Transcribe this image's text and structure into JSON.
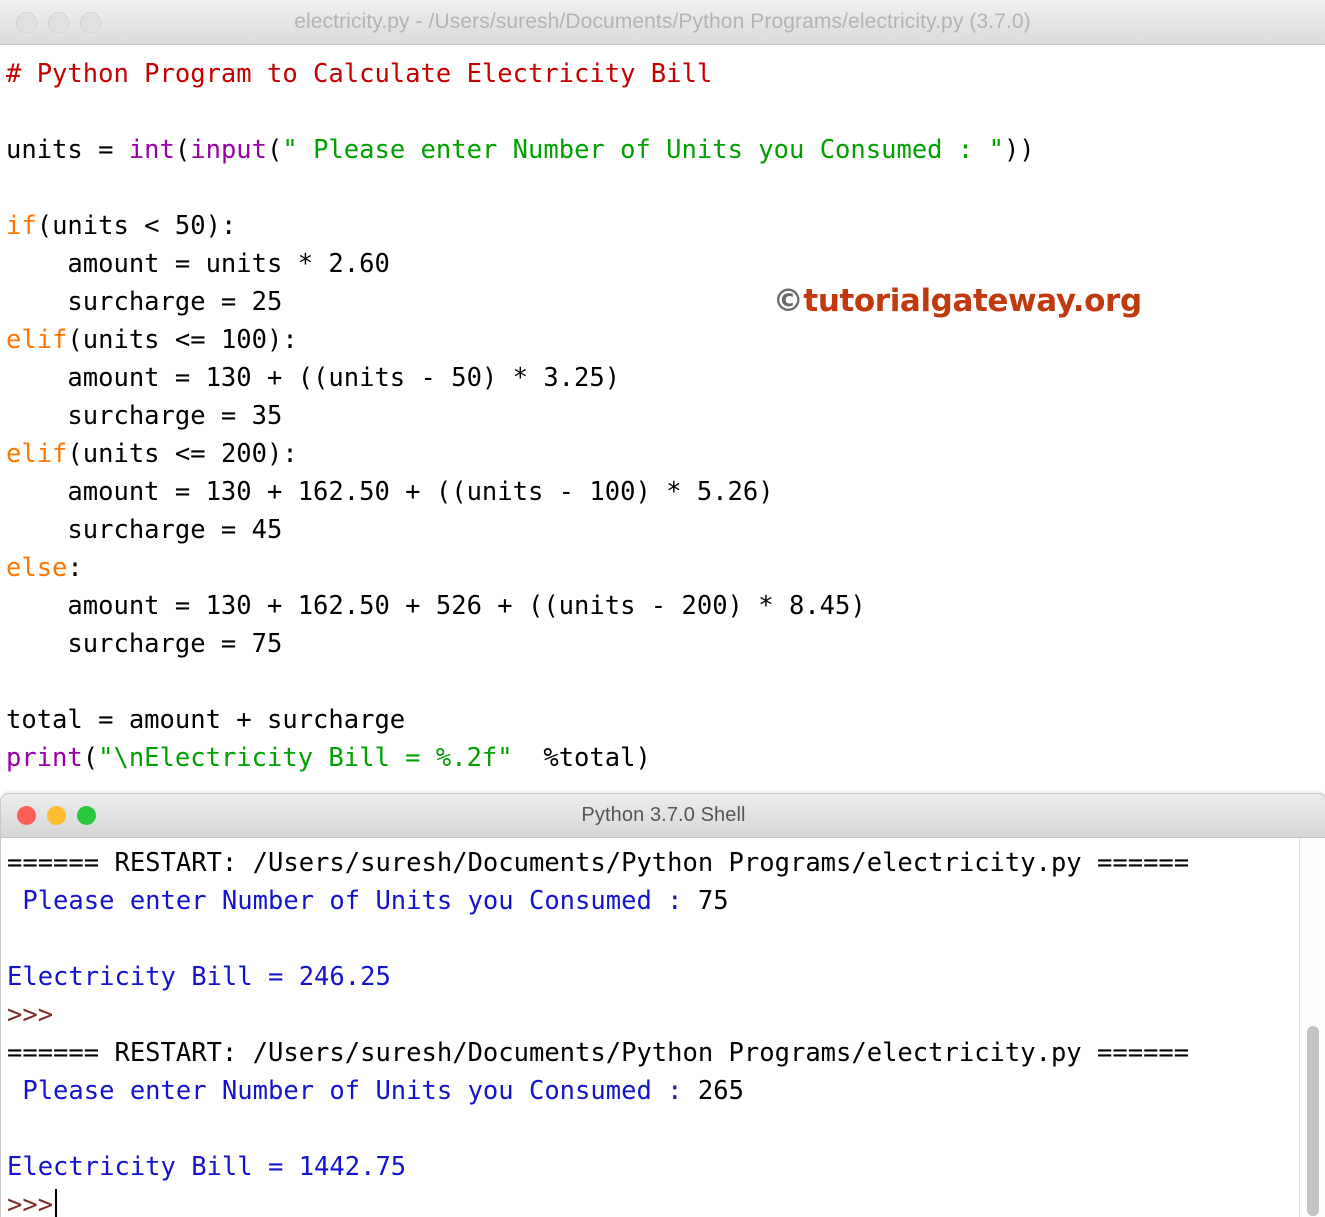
{
  "editor": {
    "title": "electricity.py - /Users/suresh/Documents/Python Programs/electricity.py (3.7.0)",
    "window_buttons": [
      "close-button",
      "minimize-button",
      "zoom-button"
    ],
    "code_lines": [
      {
        "id": "l1",
        "parts": [
          {
            "text": "# Python Program to Calculate Electricity Bill",
            "cls": "comment"
          }
        ]
      },
      {
        "id": "l2",
        "parts": [
          {
            "text": "",
            "cls": "plain"
          }
        ]
      },
      {
        "id": "l3",
        "parts": [
          {
            "text": "units = ",
            "cls": "plain"
          },
          {
            "text": "int",
            "cls": "builtin"
          },
          {
            "text": "(",
            "cls": "plain"
          },
          {
            "text": "input",
            "cls": "builtin"
          },
          {
            "text": "(",
            "cls": "plain"
          },
          {
            "text": "\" Please enter Number of Units you Consumed : \"",
            "cls": "str"
          },
          {
            "text": "))",
            "cls": "plain"
          }
        ]
      },
      {
        "id": "l4",
        "parts": [
          {
            "text": "",
            "cls": "plain"
          }
        ]
      },
      {
        "id": "l5",
        "parts": [
          {
            "text": "if",
            "cls": "kw"
          },
          {
            "text": "(units < 50):",
            "cls": "plain"
          }
        ]
      },
      {
        "id": "l6",
        "parts": [
          {
            "text": "    amount = units * 2.60",
            "cls": "plain"
          }
        ]
      },
      {
        "id": "l7",
        "parts": [
          {
            "text": "    surcharge = 25",
            "cls": "plain"
          }
        ]
      },
      {
        "id": "l8",
        "parts": [
          {
            "text": "elif",
            "cls": "kw"
          },
          {
            "text": "(units <= 100):",
            "cls": "plain"
          }
        ]
      },
      {
        "id": "l9",
        "parts": [
          {
            "text": "    amount = 130 + ((units - 50) * 3.25)",
            "cls": "plain"
          }
        ]
      },
      {
        "id": "l10",
        "parts": [
          {
            "text": "    surcharge = 35",
            "cls": "plain"
          }
        ]
      },
      {
        "id": "l11",
        "parts": [
          {
            "text": "elif",
            "cls": "kw"
          },
          {
            "text": "(units <= 200):",
            "cls": "plain"
          }
        ]
      },
      {
        "id": "l12",
        "parts": [
          {
            "text": "    amount = 130 + 162.50 + ((units - 100) * 5.26)",
            "cls": "plain"
          }
        ]
      },
      {
        "id": "l13",
        "parts": [
          {
            "text": "    surcharge = 45",
            "cls": "plain"
          }
        ]
      },
      {
        "id": "l14",
        "parts": [
          {
            "text": "else",
            "cls": "kw"
          },
          {
            "text": ":",
            "cls": "plain"
          }
        ]
      },
      {
        "id": "l15",
        "parts": [
          {
            "text": "    amount = 130 + 162.50 + 526 + ((units - 200) * 8.45)",
            "cls": "plain"
          }
        ]
      },
      {
        "id": "l16",
        "parts": [
          {
            "text": "    surcharge = 75",
            "cls": "plain"
          }
        ]
      },
      {
        "id": "l17",
        "parts": [
          {
            "text": "",
            "cls": "plain"
          }
        ]
      },
      {
        "id": "l18",
        "parts": [
          {
            "text": "total = amount + surcharge",
            "cls": "plain"
          }
        ]
      },
      {
        "id": "l19",
        "parts": [
          {
            "text": "print",
            "cls": "builtin"
          },
          {
            "text": "(",
            "cls": "plain"
          },
          {
            "text": "\"\\nElectricity Bill = %.2f\"",
            "cls": "str"
          },
          {
            "text": "  %total)",
            "cls": "plain"
          }
        ]
      }
    ]
  },
  "watermark": {
    "copyright_symbol": "©",
    "text": "tutorialgateway.org",
    "color": "#c1390e"
  },
  "shell": {
    "title": "Python 3.7.0 Shell",
    "window_buttons": [
      "close-button",
      "minimize-button",
      "zoom-button"
    ],
    "output_lines": [
      {
        "id": "s1",
        "parts": [
          {
            "text": "====== RESTART: /Users/suresh/Documents/Python Programs/electricity.py ======",
            "cls": "plain"
          }
        ]
      },
      {
        "id": "s2",
        "parts": [
          {
            "text": " Please enter Number of Units you Consumed : ",
            "cls": "out"
          },
          {
            "text": "75",
            "cls": "plain"
          }
        ]
      },
      {
        "id": "s3",
        "parts": [
          {
            "text": "",
            "cls": "plain"
          }
        ]
      },
      {
        "id": "s4",
        "parts": [
          {
            "text": "Electricity Bill = 246.25",
            "cls": "out"
          }
        ]
      },
      {
        "id": "s5",
        "parts": [
          {
            "text": ">>>",
            "cls": "prmt"
          }
        ]
      },
      {
        "id": "s6",
        "parts": [
          {
            "text": "====== RESTART: /Users/suresh/Documents/Python Programs/electricity.py ======",
            "cls": "plain"
          }
        ]
      },
      {
        "id": "s7",
        "parts": [
          {
            "text": " Please enter Number of Units you Consumed : ",
            "cls": "out"
          },
          {
            "text": "265",
            "cls": "plain"
          }
        ]
      },
      {
        "id": "s8",
        "parts": [
          {
            "text": "",
            "cls": "plain"
          }
        ]
      },
      {
        "id": "s9",
        "parts": [
          {
            "text": "Electricity Bill = 1442.75",
            "cls": "out"
          }
        ]
      },
      {
        "id": "s10",
        "parts": [
          {
            "text": ">>>",
            "cls": "prmt"
          }
        ],
        "cursor": true
      }
    ],
    "scrollbar": {
      "name": "vertical-scrollbar"
    }
  },
  "colors": {
    "keyword": "#ff7700",
    "builtin": "#9900aa",
    "string": "#00a000",
    "comment": "#c40000",
    "shell_output": "#1414cf",
    "shell_prompt": "#7d2b2b",
    "traffic_red": "#ff5f57",
    "traffic_yellow": "#febc2e",
    "traffic_green": "#28c840"
  }
}
